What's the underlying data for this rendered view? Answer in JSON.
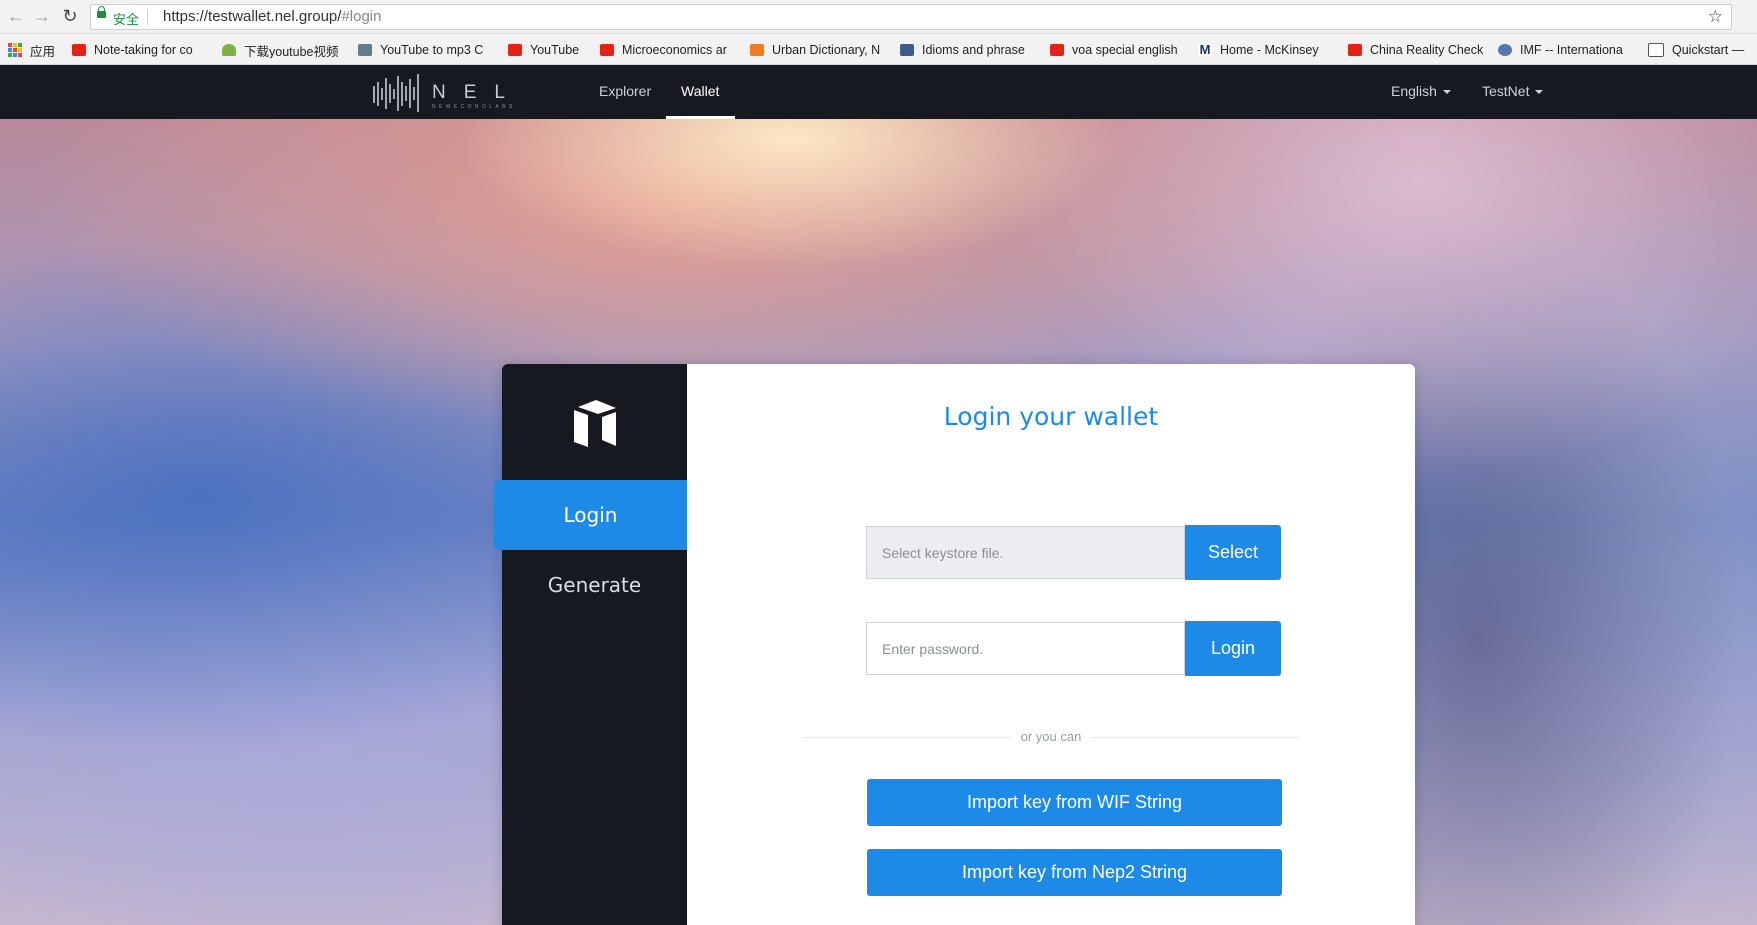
{
  "browser": {
    "secure_label": "安全",
    "url_main": "https://testwallet.nel.group/",
    "url_hash": "#login"
  },
  "bookmarks": [
    {
      "label": "应用",
      "icon": "apps-grid-icon"
    },
    {
      "label": "Note-taking for co",
      "icon": "youtube-icon"
    },
    {
      "label": "下载youtube视频",
      "icon": "download-icon"
    },
    {
      "label": "YouTube to mp3 C",
      "icon": "mp3-icon"
    },
    {
      "label": "YouTube",
      "icon": "youtube-icon"
    },
    {
      "label": "Microeconomics ar",
      "icon": "youtube-icon"
    },
    {
      "label": "Urban Dictionary, N",
      "icon": "urban-dictionary-icon"
    },
    {
      "label": "Idioms and phrase",
      "icon": "idioms-icon"
    },
    {
      "label": "voa special english",
      "icon": "youtube-icon"
    },
    {
      "label": "Home - McKinsey",
      "icon": "mckinsey-icon"
    },
    {
      "label": "China Reality Check",
      "icon": "youtube-icon"
    },
    {
      "label": "IMF -- Internationa",
      "icon": "imf-icon"
    },
    {
      "label": "Quickstart —",
      "icon": "quickstart-icon"
    }
  ],
  "navbar": {
    "logo_text": "NEL",
    "logo_subtext": "NEWECONOLABS",
    "links": [
      "Explorer",
      "Wallet"
    ],
    "active_link": "Wallet",
    "language": "English",
    "network": "TestNet"
  },
  "sidebar": {
    "items": [
      "Login",
      "Generate"
    ],
    "active": "Login"
  },
  "login": {
    "title": "Login your wallet",
    "keystore_placeholder": "Select keystore file.",
    "select_label": "Select",
    "password_placeholder": "Enter password.",
    "login_label": "Login",
    "or_text": "or you can",
    "import_wif_label": "Import key from WIF String",
    "import_nep2_label": "Import key from Nep2 String"
  },
  "colors": {
    "accent": "#1e8ae8",
    "navbar_bg": "#16191f",
    "sidebar_bg": "#16191f"
  }
}
